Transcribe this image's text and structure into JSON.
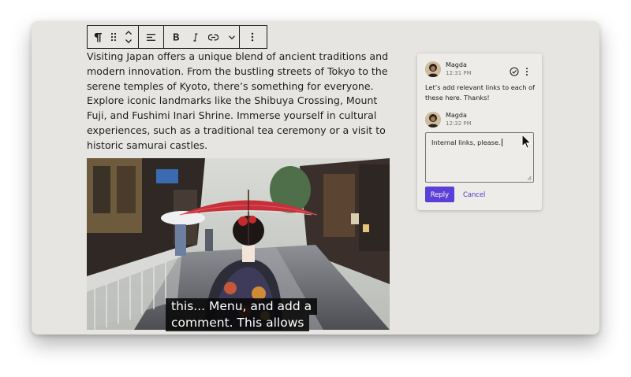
{
  "toolbar": {
    "items": [
      {
        "name": "paragraph-icon"
      },
      {
        "name": "drag-handle-icon"
      },
      {
        "name": "move-up-down-icon"
      },
      {
        "name": "align-left-icon"
      },
      {
        "name": "bold-icon"
      },
      {
        "name": "italic-icon"
      },
      {
        "name": "link-icon"
      },
      {
        "name": "chevron-down-icon"
      },
      {
        "name": "more-options-icon"
      }
    ]
  },
  "editor": {
    "paragraph": "Visiting Japan offers a unique blend of ancient traditions and modern innovation. From the bustling streets of Tokyo to the serene temples of Kyoto, there’s something for everyone. Explore iconic landmarks like the Shibuya Crossing, Mount Fuji, and Fushimi Inari Shrine. Immerse yourself in cultural experiences, such as a traditional tea ceremony or a visit to historic samurai castles."
  },
  "comments": {
    "thread": [
      {
        "author": "Magda",
        "time": "12:31 PM",
        "text": "Let’s add relevant links to each of these here. Thanks!"
      },
      {
        "author": "Magda",
        "time": "12:32 PM"
      }
    ],
    "reply_input_value": "Internal links, please.",
    "reply_label": "Reply",
    "cancel_label": "Cancel"
  },
  "caption": {
    "line1": "this... Menu, and add a",
    "line2": "comment. This allows"
  },
  "colors": {
    "accent": "#5b3fd6",
    "background": "#e7e5e1",
    "text": "#1e1e1e"
  }
}
